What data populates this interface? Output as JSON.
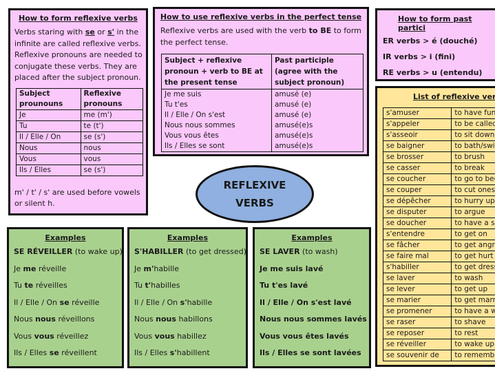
{
  "form_box": {
    "title": "How to form reflexive verbs",
    "para_1": "Verbs staring with ",
    "para_se": "se",
    "para_2": " or ",
    "para_s": "s'",
    "para_3": " in the infinite are called reflexive verbs. Reflexive pronouns are needed to conjugate these verbs. They are placed after the subject pronoun.",
    "table_headers": [
      "Subject prounouns",
      "Reflexive pronouns"
    ],
    "rows": [
      {
        "subject": "Je",
        "pronoun": "me (m')"
      },
      {
        "subject": "Tu",
        "pronoun": "te (t')"
      },
      {
        "subject": "Il / Elle / On",
        "pronoun": "se (s')"
      },
      {
        "subject": "Nous",
        "pronoun": "nous"
      },
      {
        "subject": "Vous",
        "pronoun": "vous"
      },
      {
        "subject": "Ils / Elles",
        "pronoun": "se (s')"
      }
    ],
    "note": "m' / t' / s' are used before vowels or silent h."
  },
  "perfect_box": {
    "title": "How to use reflexive verbs in the perfect tense",
    "para_1": "Reflexive verbs are used with the verb ",
    "para_bold": "to BE",
    "para_2": " to form the perfect tense.",
    "table_headers": [
      "Subject + reflexive pronoun + verb to BE at the present tense",
      "Past participle (agree with the subject pronoun)"
    ],
    "rows": [
      {
        "subject": "Je me suis",
        "participle": "amusé (e)"
      },
      {
        "subject": "Tu t'es",
        "participle": "amusé (e)"
      },
      {
        "subject": "Il / Elle / On s'est",
        "participle": "amusé (e)"
      },
      {
        "subject": "Nous nous sommes",
        "participle": "amusé(e)s"
      },
      {
        "subject": "Vous vous êtes",
        "participle": "amusé(e)s"
      },
      {
        "subject": "Ils / Elles se sont",
        "participle": "amusé(e)s"
      }
    ]
  },
  "participle_box": {
    "title": "How to form past partici",
    "lines": [
      "ER verbs > é (douché)",
      "IR verbs > i (fini)",
      "RE verbs > u (entendu)"
    ]
  },
  "list_box": {
    "title": "List of reflexive verbs",
    "rows": [
      {
        "fr": "s'amuser",
        "en": "to have fun"
      },
      {
        "fr": "s'appeler",
        "en": "to be called"
      },
      {
        "fr": "s'asseoir",
        "en": "to sit down"
      },
      {
        "fr": "se baigner",
        "en": "to bath/swim"
      },
      {
        "fr": "se brosser",
        "en": "to brush"
      },
      {
        "fr": "se casser",
        "en": "to break"
      },
      {
        "fr": "se coucher",
        "en": "to go to bed"
      },
      {
        "fr": "se couper",
        "en": "to cut oneself"
      },
      {
        "fr": "se dépêcher",
        "en": "to hurry up"
      },
      {
        "fr": "se disputer",
        "en": "to argue"
      },
      {
        "fr": "se doucher",
        "en": "to have a shower"
      },
      {
        "fr": "s'entendre",
        "en": "to get on"
      },
      {
        "fr": "se fâcher",
        "en": "to get angry"
      },
      {
        "fr": "se faire mal",
        "en": "to get hurt"
      },
      {
        "fr": "s'habiller",
        "en": "to get dressed"
      },
      {
        "fr": "se laver",
        "en": "to wash"
      },
      {
        "fr": "se lever",
        "en": "to get up"
      },
      {
        "fr": "se marier",
        "en": "to get married"
      },
      {
        "fr": "se promener",
        "en": "to have a walk"
      },
      {
        "fr": "se raser",
        "en": "to shave"
      },
      {
        "fr": "se reposer",
        "en": "to rest"
      },
      {
        "fr": "se réveiller",
        "en": "to wake up"
      },
      {
        "fr": "se souvenir de",
        "en": "to remember"
      }
    ]
  },
  "center": {
    "line_1": "REFLEXIVE",
    "line_2": "VERBS"
  },
  "examples": [
    {
      "title": "Examples",
      "heading_bold": "SE RÉVEILLER",
      "heading_rest": " (to wake up)",
      "lines": [
        {
          "a": "Je ",
          "b": "me",
          "c": " réveille"
        },
        {
          "a": "Tu ",
          "b": "te",
          "c": " réveilles"
        },
        {
          "a": "Il / Elle / On ",
          "b": "se",
          "c": " réveille"
        },
        {
          "a": "Nous ",
          "b": "nous",
          "c": " réveillons"
        },
        {
          "a": "Vous ",
          "b": "vous",
          "c": " réveillez"
        },
        {
          "a": "Ils / Elles ",
          "b": "se",
          "c": " réveillent"
        }
      ]
    },
    {
      "title": "Examples",
      "heading_bold": "S'HABILLER",
      "heading_rest": " (to get dressed)",
      "lines": [
        {
          "a": "Je ",
          "b": "m'",
          "c": "habille"
        },
        {
          "a": "Tu ",
          "b": "t'",
          "c": "habilles"
        },
        {
          "a": "Il / Elle / On ",
          "b": "s'",
          "c": "habille"
        },
        {
          "a": "Nous ",
          "b": "nous",
          "c": " habillons"
        },
        {
          "a": "Vous ",
          "b": "vous",
          "c": " habillez"
        },
        {
          "a": "Ils / Elles ",
          "b": "s'",
          "c": "habillent"
        }
      ]
    },
    {
      "title": "Examples",
      "heading_bold": "SE LAVER",
      "heading_rest": " (to wash)",
      "lines": [
        "Je me suis lavé",
        "Tu t'es lavé",
        "Il / Elle / On s'est lavé",
        "Nous nous sommes lavés",
        "Vous vous êtes lavés",
        "Ils / Elles se sont lavées"
      ]
    }
  ]
}
